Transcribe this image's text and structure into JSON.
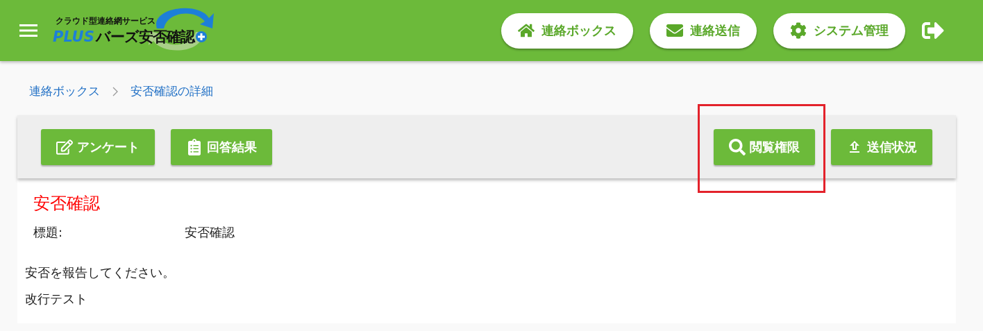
{
  "header": {
    "logo": {
      "tagline": "クラウド型連絡網サービス",
      "prefix": "PLUS",
      "name": "バーズ安否確認"
    },
    "nav": [
      {
        "label": "連絡ボックス"
      },
      {
        "label": "連絡送信"
      },
      {
        "label": "システム管理"
      }
    ]
  },
  "breadcrumb": [
    {
      "label": "連絡ボックス"
    },
    {
      "label": "安否確認の詳細"
    }
  ],
  "toolbar": {
    "left": [
      {
        "label": "アンケート"
      },
      {
        "label": "回答結果"
      }
    ],
    "right": [
      {
        "label": "閲覧権限",
        "highlighted": true
      },
      {
        "label": "送信状況",
        "highlighted": false
      }
    ]
  },
  "detail": {
    "title": "安否確認",
    "fields": [
      {
        "label": "標題:",
        "value": "安否確認"
      }
    ],
    "body": [
      "安否を報告してください。",
      "改行テスト"
    ]
  }
}
